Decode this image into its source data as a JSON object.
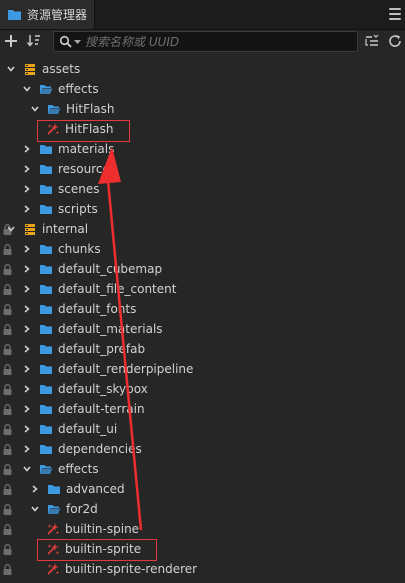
{
  "panel": {
    "title": "资源管理器"
  },
  "toolbar": {
    "search_placeholder": "搜索名称或 UUID"
  },
  "colors": {
    "folder": "#3d9ae0",
    "db": "#e8a317",
    "effect": "#e0413e",
    "highlight": "#e0393e",
    "lock": "#6d6d6d"
  },
  "tree": [
    {
      "label": "assets",
      "icon": "db",
      "level": 0,
      "arrow": "down",
      "lock": false
    },
    {
      "label": "effects",
      "icon": "folder-open",
      "level": 1,
      "arrow": "down",
      "lock": false
    },
    {
      "label": "HitFlash",
      "icon": "folder-open",
      "level": 2,
      "arrow": "down",
      "lock": false
    },
    {
      "label": "HitFlash",
      "icon": "effect",
      "level": 3,
      "arrow": "",
      "lock": false
    },
    {
      "label": "materials",
      "icon": "folder",
      "level": 1,
      "arrow": "right",
      "lock": false
    },
    {
      "label": "resources",
      "icon": "folder",
      "level": 1,
      "arrow": "right",
      "lock": false
    },
    {
      "label": "scenes",
      "icon": "folder",
      "level": 1,
      "arrow": "right",
      "lock": false
    },
    {
      "label": "scripts",
      "icon": "folder",
      "level": 1,
      "arrow": "right",
      "lock": false
    },
    {
      "label": "internal",
      "icon": "db",
      "level": 0,
      "arrow": "down",
      "lock": true
    },
    {
      "label": "chunks",
      "icon": "folder",
      "level": 1,
      "arrow": "right",
      "lock": true
    },
    {
      "label": "default_cubemap",
      "icon": "folder",
      "level": 1,
      "arrow": "right",
      "lock": true
    },
    {
      "label": "default_file_content",
      "icon": "folder",
      "level": 1,
      "arrow": "right",
      "lock": true
    },
    {
      "label": "default_fonts",
      "icon": "folder",
      "level": 1,
      "arrow": "right",
      "lock": true
    },
    {
      "label": "default_materials",
      "icon": "folder",
      "level": 1,
      "arrow": "right",
      "lock": true
    },
    {
      "label": "default_prefab",
      "icon": "folder",
      "level": 1,
      "arrow": "right",
      "lock": true
    },
    {
      "label": "default_renderpipeline",
      "icon": "folder",
      "level": 1,
      "arrow": "right",
      "lock": true
    },
    {
      "label": "default_skybox",
      "icon": "folder",
      "level": 1,
      "arrow": "right",
      "lock": true
    },
    {
      "label": "default-terrain",
      "icon": "folder",
      "level": 1,
      "arrow": "right",
      "lock": true
    },
    {
      "label": "default_ui",
      "icon": "folder",
      "level": 1,
      "arrow": "right",
      "lock": true
    },
    {
      "label": "dependencies",
      "icon": "folder",
      "level": 1,
      "arrow": "right",
      "lock": true
    },
    {
      "label": "effects",
      "icon": "folder-open",
      "level": 1,
      "arrow": "down",
      "lock": true
    },
    {
      "label": "advanced",
      "icon": "folder",
      "level": 2,
      "arrow": "right",
      "lock": true
    },
    {
      "label": "for2d",
      "icon": "folder-open",
      "level": 2,
      "arrow": "down",
      "lock": true
    },
    {
      "label": "builtin-spine",
      "icon": "effect",
      "level": 3,
      "arrow": "",
      "lock": true
    },
    {
      "label": "builtin-sprite",
      "icon": "effect",
      "level": 3,
      "arrow": "",
      "lock": true
    },
    {
      "label": "builtin-sprite-renderer",
      "icon": "effect",
      "level": 3,
      "arrow": "",
      "lock": true
    }
  ]
}
